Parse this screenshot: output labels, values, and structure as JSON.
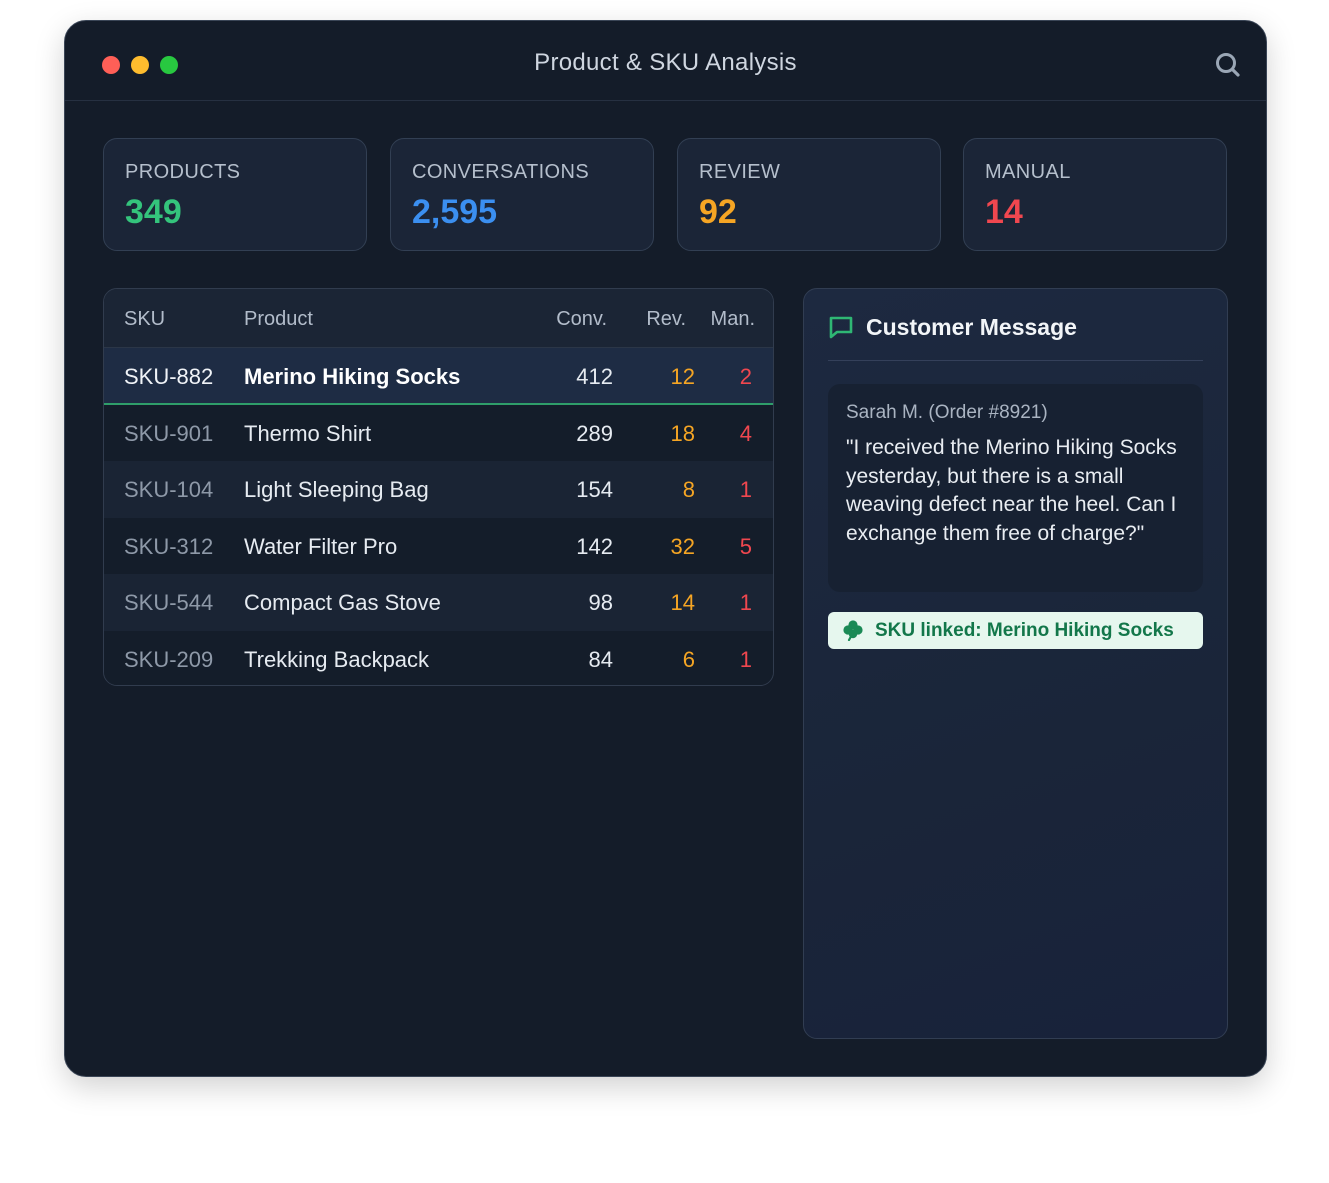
{
  "window": {
    "title": "Product & SKU Analysis"
  },
  "stats": [
    {
      "label": "PRODUCTS",
      "value": "349",
      "color": "#34c47c"
    },
    {
      "label": "CONVERSATIONS",
      "value": "2,595",
      "color": "#3b8ff0"
    },
    {
      "label": "REVIEW",
      "value": "92",
      "color": "#f5a524"
    },
    {
      "label": "MANUAL",
      "value": "14",
      "color": "#f0474f"
    }
  ],
  "table": {
    "headers": {
      "sku": "SKU",
      "product": "Product",
      "conv": "Conv.",
      "rev": "Rev.",
      "man": "Man."
    },
    "rows": [
      {
        "sku": "SKU-882",
        "product": "Merino Hiking Socks",
        "conv": "412",
        "rev": "12",
        "man": "2",
        "selected": true
      },
      {
        "sku": "SKU-901",
        "product": "Thermo Shirt",
        "conv": "289",
        "rev": "18",
        "man": "4"
      },
      {
        "sku": "SKU-104",
        "product": "Light Sleeping Bag",
        "conv": "154",
        "rev": "8",
        "man": "1"
      },
      {
        "sku": "SKU-312",
        "product": "Water Filter Pro",
        "conv": "142",
        "rev": "32",
        "man": "5"
      },
      {
        "sku": "SKU-544",
        "product": "Compact Gas Stove",
        "conv": "98",
        "rev": "14",
        "man": "1"
      },
      {
        "sku": "SKU-209",
        "product": "Trekking Backpack",
        "conv": "84",
        "rev": "6",
        "man": "1"
      }
    ]
  },
  "message": {
    "title": "Customer Message",
    "author": "Sarah M. (Order #8921)",
    "text": "\"I received the Merino Hiking Socks yesterday, but there is a small weaving defect near the heel. Can I exchange them free of charge?\"",
    "linked_label": "SKU linked: Merino Hiking Socks"
  },
  "icons": {
    "search": "search-icon",
    "message": "chat-bubble-icon",
    "linked": "clover-icon"
  },
  "colors": {
    "accent_green": "#2f9e6a",
    "review": "#f5a524",
    "manual": "#f0474f"
  }
}
